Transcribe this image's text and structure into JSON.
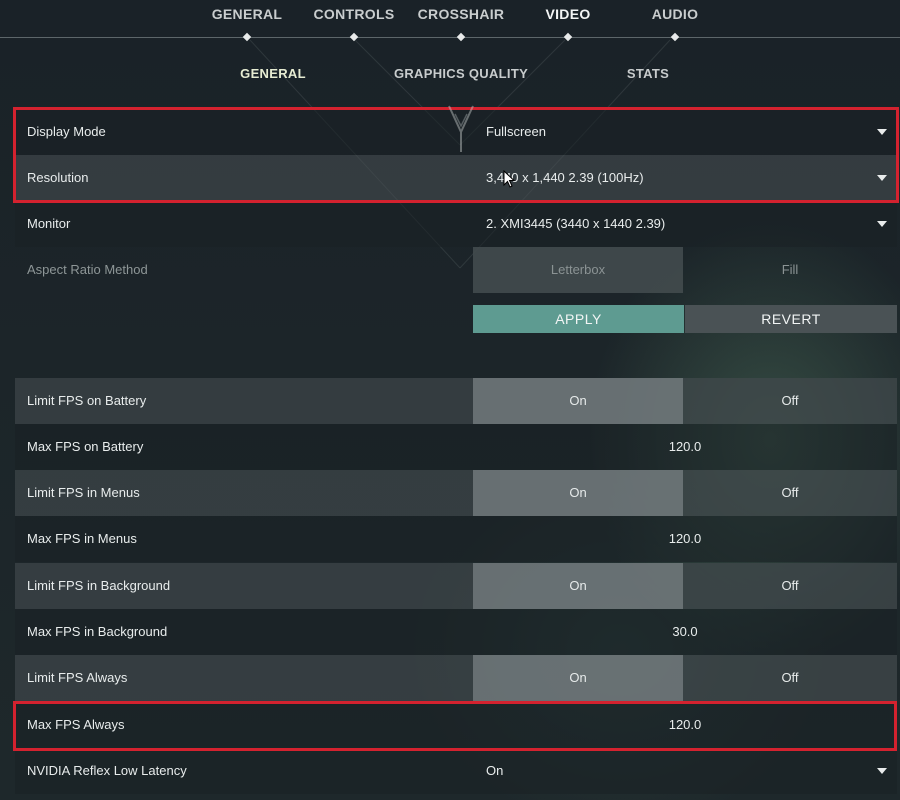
{
  "top_tabs": [
    {
      "label": "GENERAL",
      "active": false
    },
    {
      "label": "CONTROLS",
      "active": false
    },
    {
      "label": "CROSSHAIR",
      "active": false
    },
    {
      "label": "VIDEO",
      "active": true
    },
    {
      "label": "AUDIO",
      "active": false
    }
  ],
  "sub_tabs": [
    {
      "label": "GENERAL",
      "active": true
    },
    {
      "label": "GRAPHICS QUALITY",
      "active": false
    },
    {
      "label": "STATS",
      "active": false
    }
  ],
  "settings": {
    "display_mode": {
      "label": "Display Mode",
      "value": "Fullscreen"
    },
    "resolution": {
      "label": "Resolution",
      "value": "3,440 x 1,440 2.39 (100Hz)"
    },
    "monitor": {
      "label": "Monitor",
      "value": "2. XMI3445 (3440 x  1440 2.39)"
    },
    "aspect_ratio": {
      "label": "Aspect Ratio Method",
      "option_a": "Letterbox",
      "option_b": "Fill",
      "enabled": false
    },
    "apply_label": "APPLY",
    "revert_label": "REVERT",
    "limit_fps_battery": {
      "label": "Limit FPS on Battery",
      "on": "On",
      "off": "Off",
      "selected": "On"
    },
    "max_fps_battery": {
      "label": "Max FPS on Battery",
      "value": "120.0"
    },
    "limit_fps_menus": {
      "label": "Limit FPS in Menus",
      "on": "On",
      "off": "Off",
      "selected": "On"
    },
    "max_fps_menus": {
      "label": "Max FPS in Menus",
      "value": "120.0"
    },
    "limit_fps_background": {
      "label": "Limit FPS in Background",
      "on": "On",
      "off": "Off",
      "selected": "On"
    },
    "max_fps_background": {
      "label": "Max FPS in Background",
      "value": "30.0"
    },
    "limit_fps_always": {
      "label": "Limit FPS Always",
      "on": "On",
      "off": "Off",
      "selected": "On"
    },
    "max_fps_always": {
      "label": "Max FPS Always",
      "value": "120.0"
    },
    "reflex": {
      "label": "NVIDIA Reflex Low Latency",
      "value": "On"
    }
  },
  "colors": {
    "accent_apply": "#5e9b91",
    "highlight": "#d4222f"
  },
  "icons": [
    "chevron-down-icon",
    "cursor-icon",
    "valorant-v-icon"
  ]
}
